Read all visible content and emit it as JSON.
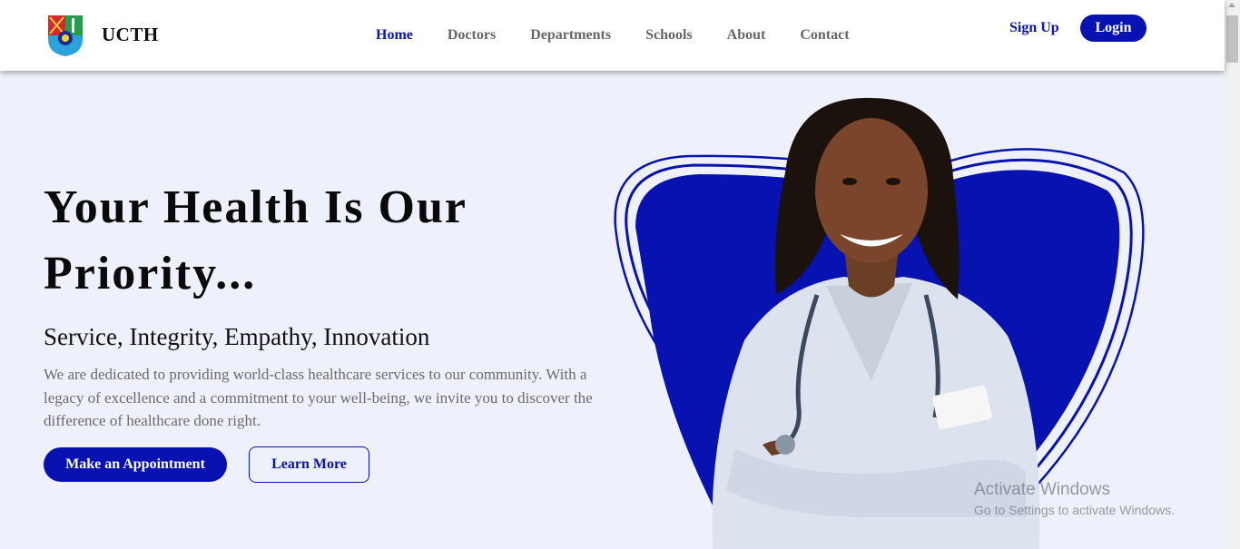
{
  "header": {
    "brand": "UCTH",
    "nav": [
      {
        "label": "Home",
        "active": true
      },
      {
        "label": "Doctors"
      },
      {
        "label": "Departments"
      },
      {
        "label": "Schools"
      },
      {
        "label": "About"
      },
      {
        "label": "Contact"
      }
    ],
    "signup_label": "Sign Up",
    "login_label": "Login"
  },
  "hero": {
    "title": "Your Health Is Our Priority...",
    "subtitle": "Service, Integrity, Empathy, Innovation",
    "description": "We are dedicated to providing world-class healthcare services to our community. With a legacy of excellence and a commitment to your well-being, we invite you to discover the difference of healthcare done right.",
    "primary_button": "Make an Appointment",
    "secondary_button": "Learn More"
  },
  "watermark": {
    "title": "Activate Windows",
    "subtitle": "Go to Settings to activate Windows."
  },
  "colors": {
    "accent": "#0712b0",
    "background": "#eef1fb",
    "nav_inactive": "#666666"
  },
  "icons": [
    "crest-logo-icon",
    "doctor-illustration"
  ]
}
